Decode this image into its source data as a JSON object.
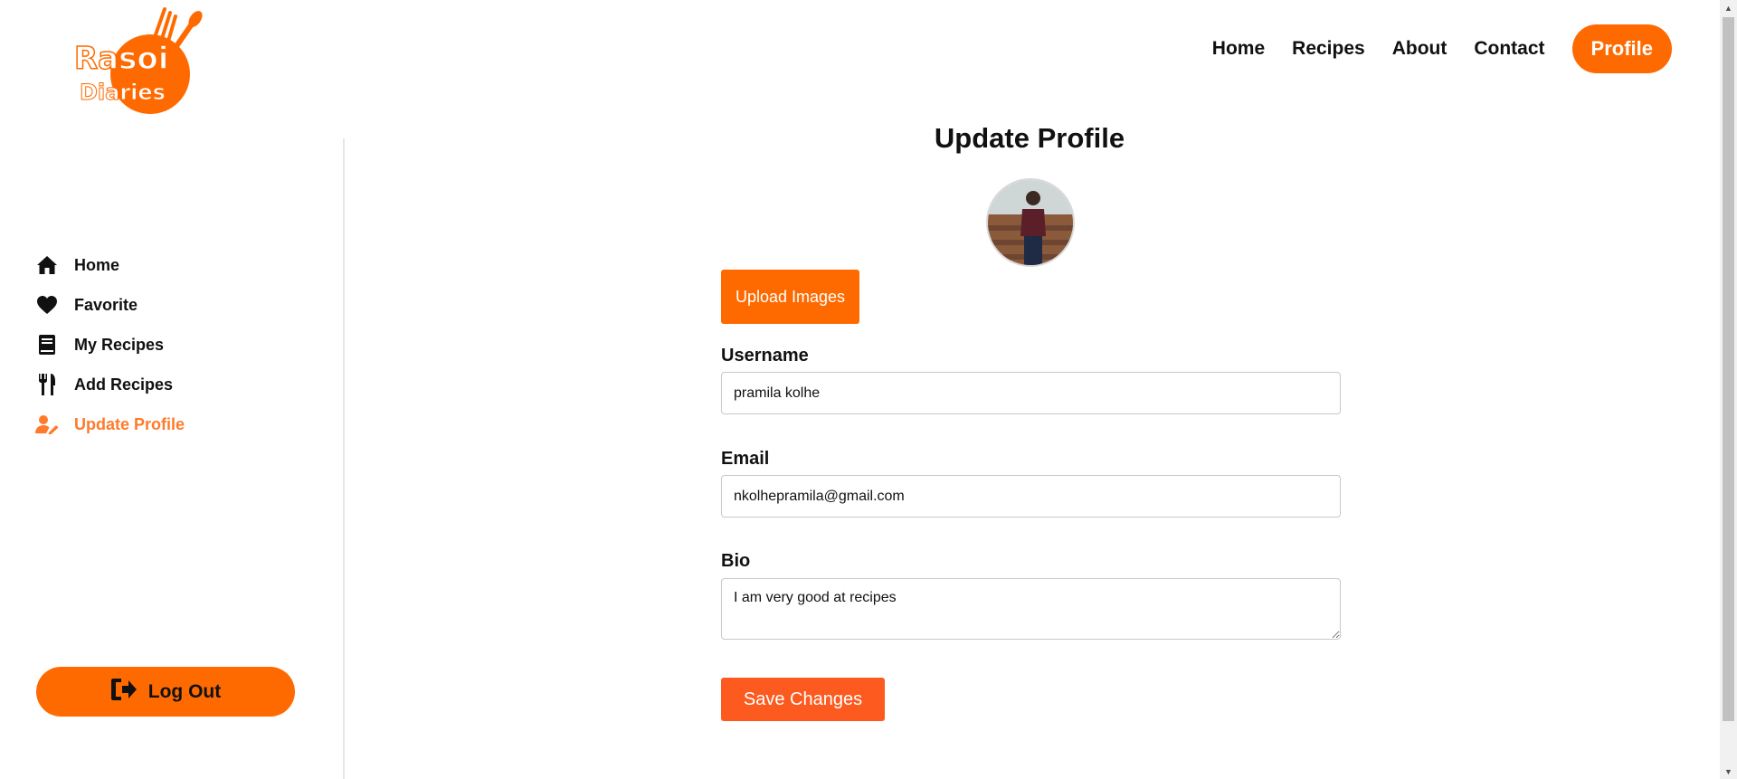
{
  "brand": {
    "logo_line1": "Rasoi",
    "logo_line2": "Diaries",
    "accent": "#ff6a00"
  },
  "topnav": {
    "items": [
      {
        "label": "Home"
      },
      {
        "label": "Recipes"
      },
      {
        "label": "About"
      },
      {
        "label": "Contact"
      }
    ],
    "profile_label": "Profile"
  },
  "sidebar": {
    "items": [
      {
        "label": "Home",
        "icon": "home-icon"
      },
      {
        "label": "Favorite",
        "icon": "heart-icon"
      },
      {
        "label": "My Recipes",
        "icon": "book-icon"
      },
      {
        "label": "Add Recipes",
        "icon": "utensils-icon"
      },
      {
        "label": "Update Profile",
        "icon": "user-edit-icon",
        "active": true
      }
    ],
    "logout_label": "Log Out"
  },
  "form": {
    "title": "Update Profile",
    "upload_label": "Upload Images",
    "username_label": "Username",
    "username_value": "pramila kolhe",
    "email_label": "Email",
    "email_value": "nkolhepramila@gmail.com",
    "bio_label": "Bio",
    "bio_value": "I am very good at recipes",
    "save_label": "Save Changes"
  }
}
